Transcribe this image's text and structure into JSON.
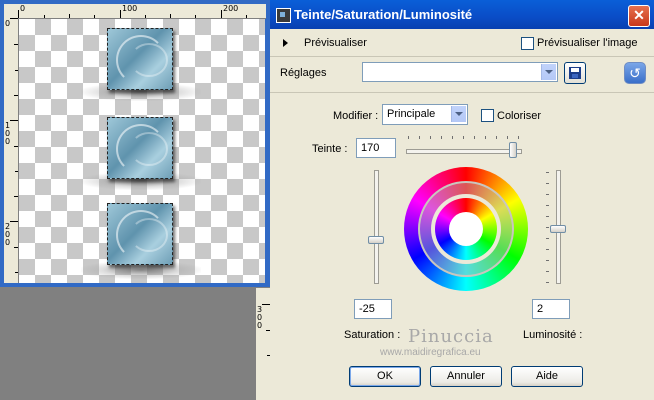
{
  "canvas": {
    "ruler_labels": [
      "0",
      "100",
      "200"
    ],
    "ruler_v_labels": [
      "0",
      "1\n0\n0",
      "2\n0\n0"
    ],
    "ruler_v2_labels": [
      "3\n0\n0"
    ]
  },
  "dialog": {
    "title": "Teinte/Saturation/Luminosité",
    "close_label": "✕",
    "preview_label": "Prévisualiser",
    "preview_image_label": "Prévisualiser l'image",
    "settings_label": "Réglages",
    "settings_value": "",
    "modifier_label": "Modifier :",
    "modifier_value": "Principale",
    "colorize_label": "Coloriser",
    "hue_label": "Teinte :",
    "hue_value": "170",
    "hue_level": 0.94,
    "saturation_value": "-25",
    "saturation_label": "Saturation :",
    "saturation_level": 0.56,
    "luminosity_value": "2",
    "luminosity_label": "Luminosité :",
    "luminosity_level": 0.51,
    "ok_label": "OK",
    "cancel_label": "Annuler",
    "help_label": "Aide",
    "watermark": "Pinuccia",
    "watermark_sub": "www.maidiregrafica.eu"
  },
  "icons": {
    "title": "hue-saturation-icon",
    "save": "floppy-disk-icon",
    "reset": "reset-icon"
  }
}
